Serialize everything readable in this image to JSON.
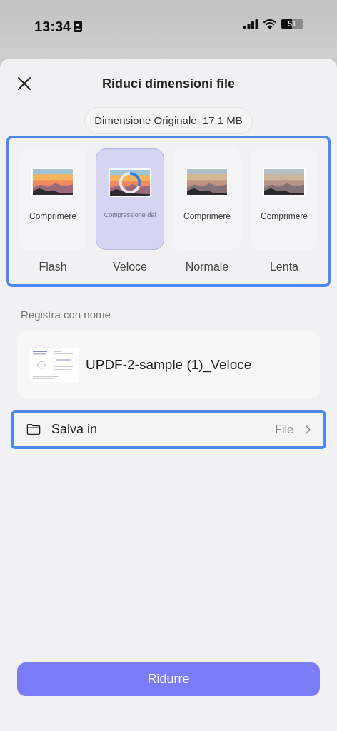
{
  "status_bar": {
    "time": "13:34",
    "battery": "51"
  },
  "sheet": {
    "title": "Riduci dimensioni file",
    "original_size": "Dimensione Originale: 17.1 MB"
  },
  "options": [
    {
      "caption": "Comprimere",
      "label": "Flash",
      "selected": false,
      "compressing": false
    },
    {
      "caption": "Compressione del",
      "label": "Veloce",
      "selected": true,
      "compressing": true
    },
    {
      "caption": "Comprimere",
      "label": "Normale",
      "selected": false,
      "compressing": false
    },
    {
      "caption": "Comprimere",
      "label": "Lenta",
      "selected": false,
      "compressing": false
    }
  ],
  "save_as": {
    "label": "Registra con nome",
    "file_name": "UPDF-2-sample (1)_Veloce"
  },
  "save_in": {
    "label": "Salva in",
    "value": "File"
  },
  "primary_button": "Ridurre"
}
